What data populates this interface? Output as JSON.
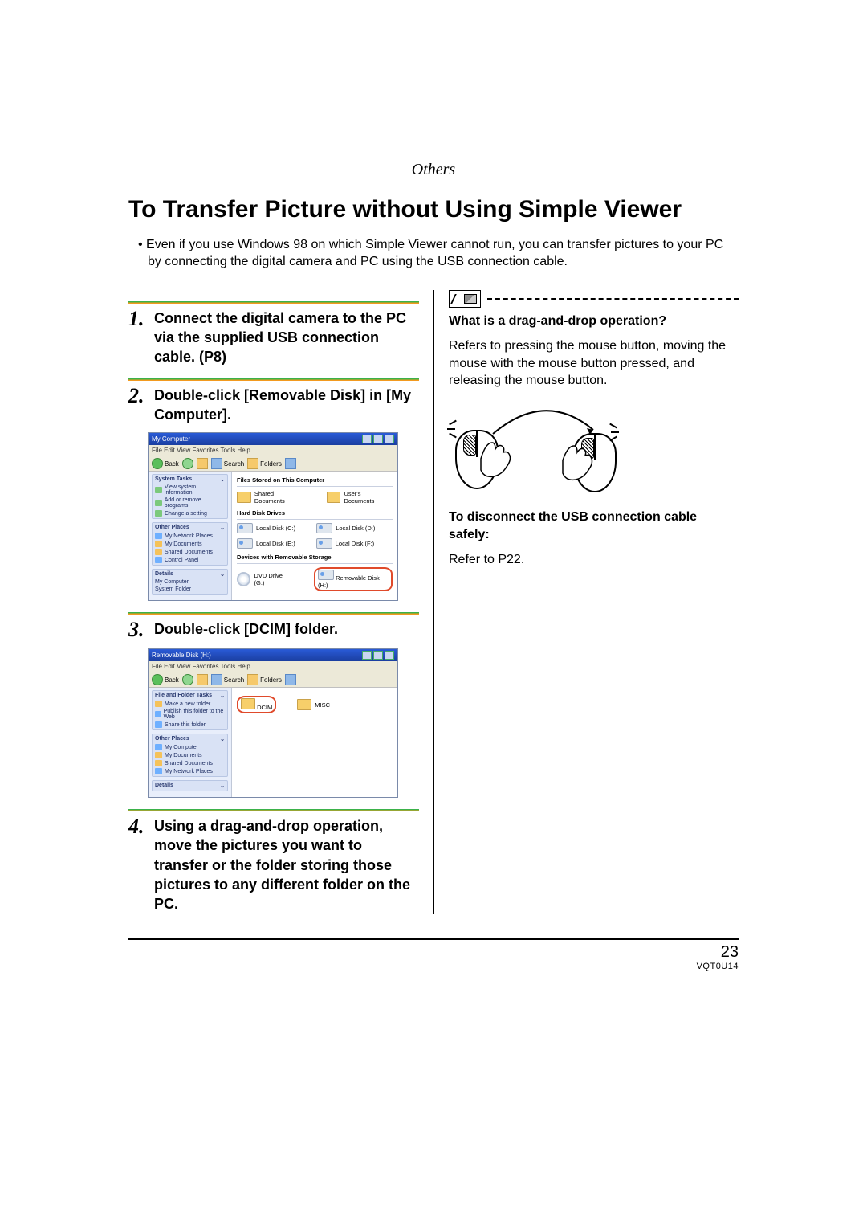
{
  "header": {
    "section": "Others"
  },
  "title": "To Transfer Picture without Using Simple Viewer",
  "intro_bullet": "• ",
  "intro": "Even if you use Windows 98 on which Simple Viewer cannot run, you can transfer pictures to your PC by connecting the digital camera and PC using the USB connection cable.",
  "steps": [
    {
      "n": "1",
      "text": "Connect the digital camera to the PC via the supplied USB connection cable. (P8)"
    },
    {
      "n": "2",
      "text": "Double-click [Removable Disk] in [My Computer]."
    },
    {
      "n": "3",
      "text": "Double-click [DCIM] folder."
    },
    {
      "n": "4",
      "text": "Using a drag-and-drop operation, move the pictures you want to transfer or the folder storing those pictures to any different folder on the PC."
    }
  ],
  "shot1": {
    "title": "My Computer",
    "menu": "File   Edit   View   Favorites   Tools   Help",
    "toolbar": {
      "back": "Back",
      "search": "Search",
      "folders": "Folders"
    },
    "side": {
      "panel1_head": "System Tasks",
      "panel1_items": [
        "View system information",
        "Add or remove programs",
        "Change a setting"
      ],
      "panel2_head": "Other Places",
      "panel2_items": [
        "My Network Places",
        "My Documents",
        "Shared Documents",
        "Control Panel"
      ],
      "panel3_head": "Details",
      "panel3_items": [
        "My Computer",
        "System Folder"
      ]
    },
    "groups": {
      "g1": "Files Stored on This Computer",
      "g1_items": [
        "Shared Documents",
        "User's Documents"
      ],
      "g2": "Hard Disk Drives",
      "g2_items": [
        "Local Disk (C:)",
        "Local Disk (D:)",
        "Local Disk (E:)",
        "Local Disk (F:)"
      ],
      "g3": "Devices with Removable Storage",
      "g3_items": [
        "DVD Drive (G:)",
        "Removable Disk (H:)"
      ]
    }
  },
  "shot2": {
    "title": "Removable Disk (H:)",
    "menu": "File   Edit   View   Favorites   Tools   Help",
    "toolbar": {
      "back": "Back",
      "search": "Search",
      "folders": "Folders"
    },
    "side": {
      "panel1_head": "File and Folder Tasks",
      "panel1_items": [
        "Make a new folder",
        "Publish this folder to the Web",
        "Share this folder"
      ],
      "panel2_head": "Other Places",
      "panel2_items": [
        "My Computer",
        "My Documents",
        "Shared Documents",
        "My Network Places"
      ],
      "panel3_head": "Details"
    },
    "items": [
      "DCIM",
      "MISC"
    ]
  },
  "right": {
    "q": "What is a drag-and-drop operation?",
    "a": "Refers to pressing the mouse button, moving the mouse with the mouse button pressed, and releasing the mouse button.",
    "d_head": "To disconnect the USB connection cable safely:",
    "d_body": "Refer to P22."
  },
  "footer": {
    "page": "23",
    "code": "VQT0U14"
  }
}
